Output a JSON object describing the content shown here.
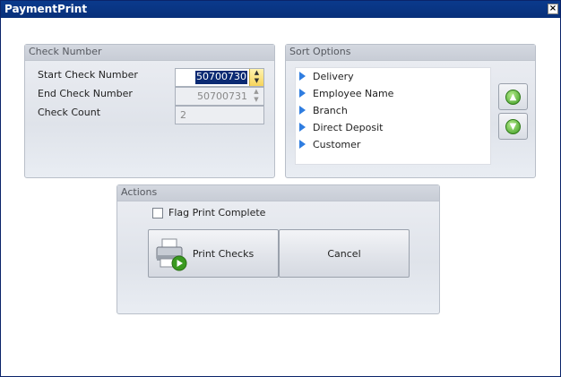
{
  "window": {
    "title": "PaymentPrint",
    "close_glyph": "×"
  },
  "check_number": {
    "header": "Check Number",
    "start_label": "Start Check Number",
    "start_value": "50700730",
    "end_label": "End Check Number",
    "end_value": "50700731",
    "count_label": "Check Count",
    "count_value": "2"
  },
  "sort_options": {
    "header": "Sort Options",
    "items": [
      "Delivery",
      "Employee Name",
      "Branch",
      "Direct Deposit",
      "Customer"
    ],
    "move_up_icon": "arrow-up-icon",
    "move_down_icon": "arrow-down-icon"
  },
  "actions": {
    "header": "Actions",
    "flag_label": "Flag Print Complete",
    "flag_checked": false,
    "print_label": "Print Checks",
    "cancel_label": "Cancel"
  },
  "colors": {
    "titlebar": "#0a3a8c",
    "selection": "#0b2a73",
    "accent_blue": "#2f7de0",
    "accent_green": "#3a9a20"
  }
}
